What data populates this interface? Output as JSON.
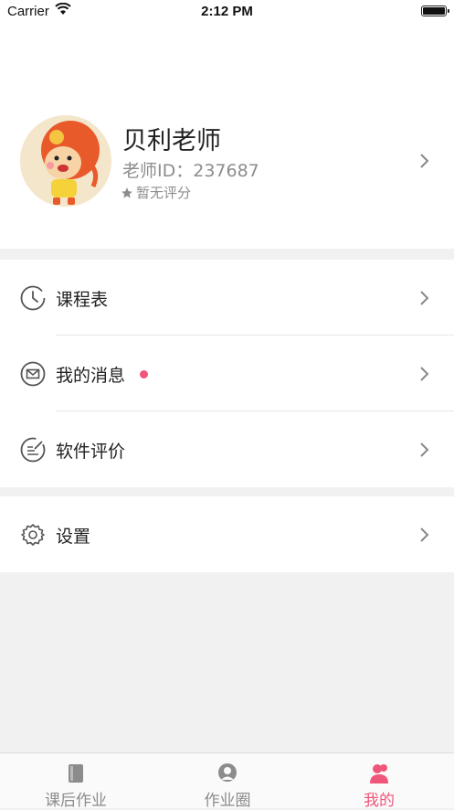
{
  "status_bar": {
    "carrier": "Carrier",
    "time": "2:12 PM"
  },
  "profile": {
    "name": "贝利老师",
    "teacher_id": "老师ID：237687",
    "rating": "暂无评分"
  },
  "menu": {
    "group1": [
      {
        "label": "课程表",
        "icon": "clock-icon"
      },
      {
        "label": "我的消息",
        "icon": "mail-icon",
        "has_unread_dot": true
      },
      {
        "label": "软件评价",
        "icon": "rate-icon"
      }
    ],
    "group2": [
      {
        "label": "设置",
        "icon": "gear-icon"
      }
    ]
  },
  "tabs": [
    {
      "label": "课后作业",
      "icon": "book-icon",
      "active": false
    },
    {
      "label": "作业圈",
      "icon": "circle-icon",
      "active": false
    },
    {
      "label": "我的",
      "icon": "person-icon",
      "active": true
    }
  ],
  "colors": {
    "accent": "#f0567a",
    "background": "#f1f1f1",
    "muted": "#8d8d8d"
  }
}
